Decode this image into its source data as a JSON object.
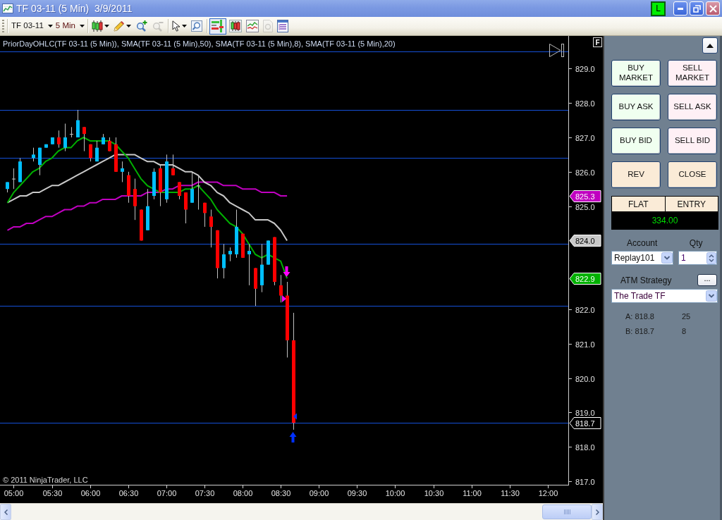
{
  "window": {
    "title": "TF 03-11 (5 Min)  3/9/2011",
    "status_letter": "L"
  },
  "toolbar": {
    "instrument": "TF 03-11",
    "interval": "5 Min",
    "groups": [
      [
        {
          "kind": "chart-style",
          "disabled": false,
          "on": false
        },
        {
          "kind": "drawing",
          "disabled": false,
          "on": false
        },
        {
          "kind": "zoom-in",
          "disabled": false,
          "on": false
        },
        {
          "kind": "zoom-out",
          "disabled": true,
          "on": false
        }
      ],
      [
        {
          "kind": "pointer",
          "disabled": false,
          "on": false
        },
        {
          "kind": "magnifier",
          "disabled": false,
          "on": false
        }
      ],
      [
        {
          "kind": "trade-panel",
          "disabled": false,
          "on": true
        },
        {
          "kind": "candles",
          "disabled": false,
          "on": false
        },
        {
          "kind": "line-chart",
          "disabled": false,
          "on": false
        },
        {
          "kind": "document",
          "disabled": true,
          "on": false
        },
        {
          "kind": "properties",
          "disabled": false,
          "on": false
        }
      ]
    ]
  },
  "chart": {
    "corner_button": "F",
    "copyright": "© 2011 NinjaTrader, LLC",
    "chart_data": [
      {
        "type": "candlestick",
        "title": "PriorDayOHLC(TF 03-11 (5 Min)), SMA(TF 03-11 (5 Min),50), SMA(TF 03-11 (5 Min),8), SMA(TF 03-11 (5 Min),20)",
        "x": [
          4.9167,
          5,
          5.0833,
          5.1667,
          5.25,
          5.3333,
          5.4167,
          5.5,
          5.5833,
          5.6667,
          5.75,
          5.8333,
          5.9167,
          6,
          6.0833,
          6.1667,
          6.25,
          6.3333,
          6.4167,
          6.5,
          6.5833,
          6.6667,
          6.75,
          6.8333,
          6.9167,
          7,
          7.0833,
          7.1667,
          7.25,
          7.3333,
          7.4167,
          7.5,
          7.5833,
          7.6667,
          7.75,
          7.8333,
          7.9167,
          8,
          8.0833,
          8.1667,
          8.25,
          8.3333,
          8.4167,
          8.5,
          8.5833,
          8.6667
        ],
        "xlim": [
          4.82,
          12.27
        ],
        "ylim": [
          816.9,
          829.95
        ],
        "xticks": [
          {
            "value": 5,
            "label": "05:00"
          },
          {
            "value": 5.5,
            "label": "05:30"
          },
          {
            "value": 6,
            "label": "06:00"
          },
          {
            "value": 6.5,
            "label": "06:30"
          },
          {
            "value": 7,
            "label": "07:00"
          },
          {
            "value": 7.5,
            "label": "07:30"
          },
          {
            "value": 8,
            "label": "08:00"
          },
          {
            "value": 8.5,
            "label": "08:30"
          },
          {
            "value": 9,
            "label": "09:00"
          },
          {
            "value": 9.5,
            "label": "09:30"
          },
          {
            "value": 10,
            "label": "10:00"
          },
          {
            "value": 10.5,
            "label": "10:30"
          },
          {
            "value": 11,
            "label": "11:00"
          },
          {
            "value": 11.5,
            "label": "11:30"
          },
          {
            "value": 12,
            "label": "12:00"
          }
        ],
        "yticks": [
          {
            "value": 817,
            "label": "817.0"
          },
          {
            "value": 818,
            "label": "818.0"
          },
          {
            "value": 819,
            "label": "819.0"
          },
          {
            "value": 820,
            "label": "820.0"
          },
          {
            "value": 821,
            "label": "821.0"
          },
          {
            "value": 822,
            "label": "822.0"
          },
          {
            "value": 825,
            "label": "825.0"
          },
          {
            "value": 826,
            "label": "826.0"
          },
          {
            "value": 827,
            "label": "827.0"
          },
          {
            "value": 828,
            "label": "828.0"
          },
          {
            "value": 829,
            "label": "829.0"
          }
        ],
        "ref_lines": [
          {
            "axis": "y",
            "value": 829.5,
            "color": "#1450d8"
          },
          {
            "axis": "y",
            "value": 827.8,
            "color": "#1450d8"
          },
          {
            "axis": "y",
            "value": 826.4,
            "color": "#1450d8"
          },
          {
            "axis": "y",
            "value": 823.9,
            "color": "#1450d8"
          },
          {
            "axis": "y",
            "value": 822.1,
            "color": "#1450d8"
          },
          {
            "axis": "y",
            "value": 818.7,
            "color": "#1450d8"
          }
        ],
        "annotations": [
          "825.3",
          "824.0",
          "822.9",
          "818.7"
        ],
        "series": [
          {
            "type": "line",
            "color": "#c000c0",
            "values": [
              824.3,
              824.4,
              824.4,
              824.5,
              824.5,
              824.6,
              824.7,
              824.7,
              824.8,
              824.9,
              824.9,
              825.0,
              825.0,
              825.1,
              825.1,
              825.2,
              825.2,
              825.2,
              825.3,
              825.3,
              825.3,
              825.3,
              825.4,
              825.4,
              825.4,
              825.5,
              825.5,
              825.6,
              825.6,
              825.6,
              825.7,
              825.7,
              825.7,
              825.7,
              825.6,
              825.6,
              825.6,
              825.5,
              825.5,
              825.5,
              825.4,
              825.4,
              825.4,
              825.3,
              825.3,
              null
            ]
          },
          {
            "type": "line",
            "color": "#c8c8c8",
            "values": [
              825.1,
              825.2,
              825.3,
              825.3,
              825.4,
              825.4,
              825.5,
              825.6,
              825.6,
              825.7,
              825.8,
              825.9,
              826.0,
              826.1,
              826.2,
              826.3,
              826.4,
              826.5,
              826.5,
              826.5,
              826.5,
              826.4,
              826.3,
              826.3,
              826.2,
              826.2,
              826.2,
              826.1,
              826.0,
              826.0,
              825.9,
              825.7,
              825.6,
              825.4,
              825.3,
              825.1,
              825.0,
              824.9,
              824.8,
              824.6,
              824.6,
              824.6,
              824.5,
              824.3,
              824.0,
              null
            ]
          },
          {
            "type": "line",
            "color": "#00b000",
            "values": [
              825.1,
              825.4,
              825.6,
              825.8,
              826.0,
              826.1,
              826.3,
              826.4,
              826.6,
              826.7,
              826.7,
              826.9,
              827.0,
              826.9,
              826.9,
              826.9,
              826.9,
              826.8,
              826.6,
              826.4,
              826.1,
              825.8,
              825.6,
              825.5,
              825.4,
              825.4,
              825.4,
              825.4,
              825.5,
              825.5,
              825.6,
              825.4,
              825.2,
              824.9,
              824.7,
              824.5,
              824.4,
              824.2,
              823.9,
              823.6,
              823.5,
              823.6,
              823.5,
              823.4,
              822.9,
              null
            ]
          },
          {
            "type": "candlestick",
            "ohlc": [
              [
                825.5,
                825.7,
                825.4,
                825.7
              ],
              [
                825.8,
                826.1,
                825.5,
                825.8
              ],
              [
                825.7,
                826.4,
                825.7,
                826.3
              ],
              null,
              [
                826.4,
                826.7,
                826.3,
                826.5
              ],
              [
                826.2,
                826.7,
                825.9,
                826.7
              ],
              [
                826.7,
                826.8,
                826.7,
                826.8
              ],
              [
                826.8,
                827.0,
                826.8,
                827.0
              ],
              [
                827.0,
                827.2,
                826.7,
                826.8
              ],
              [
                826.7,
                827.4,
                826.6,
                827.0
              ],
              [
                827.1,
                827.3,
                827.0,
                827.1
              ],
              [
                827.0,
                827.8,
                827.0,
                827.5
              ],
              [
                827.3,
                827.3,
                826.6,
                827.1
              ],
              [
                826.8,
                826.8,
                826.3,
                826.4
              ],
              [
                826.3,
                826.9,
                826.3,
                826.7
              ],
              [
                826.8,
                827.1,
                826.8,
                827.0
              ],
              [
                826.9,
                827.0,
                826.6,
                826.6
              ],
              [
                826.8,
                827.0,
                826.0,
                826.0
              ],
              [
                826.0,
                826.3,
                825.7,
                826.1
              ],
              [
                825.9,
                826.0,
                825.1,
                825.3
              ],
              [
                825.5,
                825.8,
                824.6,
                825.0
              ],
              [
                824.9,
                824.9,
                824.0,
                824.0
              ],
              [
                824.3,
                825.5,
                824.3,
                825.0
              ],
              [
                825.3,
                826.1,
                825.2,
                826.0
              ],
              [
                826.1,
                826.2,
                825.0,
                825.4
              ],
              [
                825.2,
                826.5,
                825.1,
                826.3
              ],
              [
                826.1,
                826.5,
                825.9,
                825.9
              ],
              [
                825.7,
                825.7,
                825.2,
                825.3
              ],
              [
                825.4,
                825.4,
                824.5,
                824.9
              ],
              [
                825.1,
                826.0,
                825.1,
                825.5
              ],
              [
                825.6,
                825.9,
                824.9,
                825.6
              ],
              [
                825.1,
                825.1,
                824.4,
                824.8
              ],
              [
                824.7,
                824.9,
                823.8,
                824.4
              ],
              [
                824.3,
                824.3,
                822.9,
                823.2
              ],
              [
                823.2,
                823.9,
                822.9,
                823.6
              ],
              [
                823.6,
                823.8,
                823.4,
                823.7
              ],
              [
                823.6,
                824.9,
                823.5,
                824.4
              ],
              [
                824.2,
                824.2,
                823.5,
                823.5
              ],
              [
                823.6,
                823.9,
                822.7,
                823.7
              ],
              [
                823.2,
                823.2,
                822.1,
                822.6
              ],
              [
                822.7,
                823.9,
                822.5,
                823.3
              ],
              [
                823.3,
                824.0,
                823.3,
                824.0
              ],
              [
                824.1,
                824.1,
                822.7,
                822.8
              ],
              [
                822.7,
                823.0,
                822.2,
                822.4
              ],
              [
                822.4,
                822.8,
                820.6,
                821.1
              ],
              [
                821.1,
                821.9,
                818.5,
                818.7
              ]
            ]
          }
        ]
      }
    ]
  },
  "trade_panel": {
    "buttons": [
      {
        "label": "BUY MARKET",
        "kind": "buy"
      },
      {
        "label": "SELL MARKET",
        "kind": "sell"
      },
      {
        "label": "BUY ASK",
        "kind": "buy"
      },
      {
        "label": "SELL ASK",
        "kind": "sell"
      },
      {
        "label": "BUY BID",
        "kind": "buy"
      },
      {
        "label": "SELL BID",
        "kind": "sell"
      },
      {
        "label": "REV",
        "kind": "neutral"
      },
      {
        "label": "CLOSE",
        "kind": "neutral"
      }
    ],
    "position": {
      "status": "FLAT",
      "heading_2": "ENTRY",
      "value": "334.00"
    },
    "account": {
      "label": "Account",
      "value": "Replay101"
    },
    "quantity": {
      "label": "Qty",
      "value": "1"
    },
    "atm_strategy": {
      "label": "ATM Strategy",
      "button": "...",
      "value": "The Trade TF"
    },
    "quotes": [
      {
        "price": "A: 818.8",
        "size": "25"
      },
      {
        "price": "B: 818.7",
        "size": "8"
      }
    ]
  }
}
